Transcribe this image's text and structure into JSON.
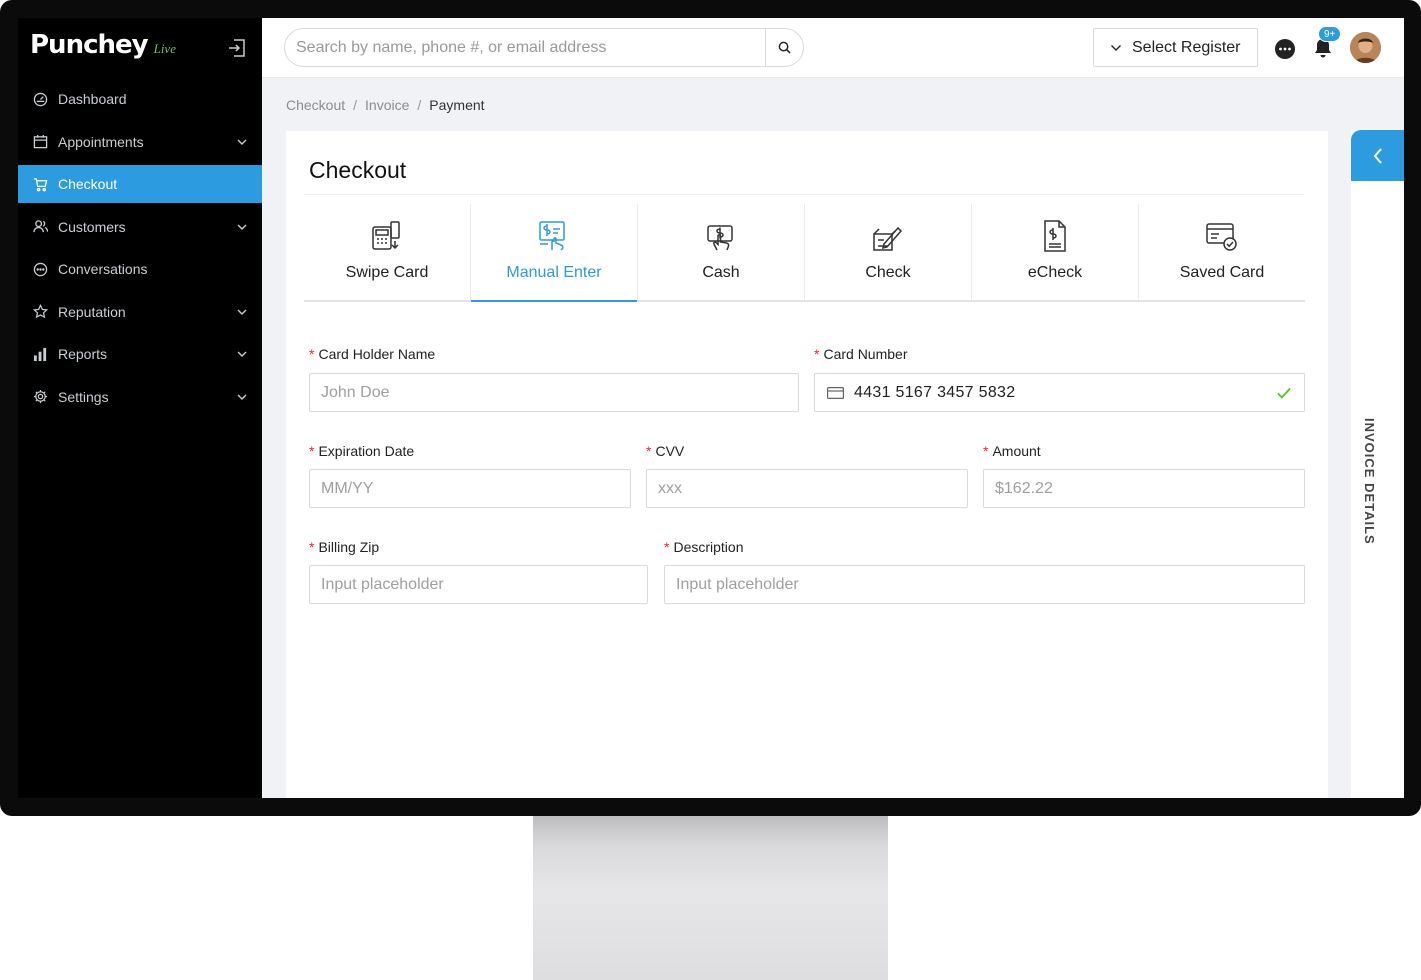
{
  "app": {
    "logo_text": "Punchey",
    "logo_suffix": "Live"
  },
  "sidebar": {
    "items": [
      {
        "label": "Dashboard",
        "icon": "dashboard-icon",
        "has_children": false,
        "active": false
      },
      {
        "label": "Appointments",
        "icon": "calendar-icon",
        "has_children": true,
        "active": false
      },
      {
        "label": "Checkout",
        "icon": "cart-icon",
        "has_children": false,
        "active": true
      },
      {
        "label": "Customers",
        "icon": "customers-icon",
        "has_children": true,
        "active": false
      },
      {
        "label": "Conversations",
        "icon": "chat-icon",
        "has_children": false,
        "active": false
      },
      {
        "label": "Reputation",
        "icon": "star-icon",
        "has_children": true,
        "active": false
      },
      {
        "label": "Reports",
        "icon": "bar-chart-icon",
        "has_children": true,
        "active": false
      },
      {
        "label": "Settings",
        "icon": "gear-icon",
        "has_children": true,
        "active": false
      }
    ]
  },
  "header": {
    "search_placeholder": "Search by name, phone #, or email address",
    "register_label": "Select Register",
    "notification_count": "9+"
  },
  "breadcrumb": [
    "Checkout",
    "Invoice",
    "Payment"
  ],
  "checkout": {
    "title": "Checkout",
    "tabs": [
      {
        "label": "Swipe Card",
        "icon": "swipe-card-icon"
      },
      {
        "label": "Manual Enter",
        "icon": "manual-enter-icon"
      },
      {
        "label": "Cash",
        "icon": "cash-icon"
      },
      {
        "label": "Check",
        "icon": "check-icon"
      },
      {
        "label": "eCheck",
        "icon": "echeck-icon"
      },
      {
        "label": "Saved Card",
        "icon": "saved-card-icon"
      }
    ],
    "active_tab": "Manual Enter",
    "form": {
      "card_holder_label": "Card Holder Name",
      "card_holder_placeholder": "John Doe",
      "card_number_label": "Card Number",
      "card_number_value": "4431 5167 3457 5832",
      "expiration_label": "Expiration Date",
      "expiration_placeholder": "MM/YY",
      "cvv_label": "CVV",
      "cvv_placeholder": "xxx",
      "amount_label": "Amount",
      "amount_placeholder": "$162.22",
      "zip_label": "Billing Zip",
      "zip_placeholder": "Input placeholder",
      "description_label": "Description",
      "description_placeholder": "Input placeholder"
    }
  },
  "right_panel": {
    "label": "INVOICE DETAILS"
  },
  "colors": {
    "accent": "#2d9be0",
    "sidebar_bg": "#000000",
    "required": "#f5222d",
    "valid": "#52c41a"
  }
}
